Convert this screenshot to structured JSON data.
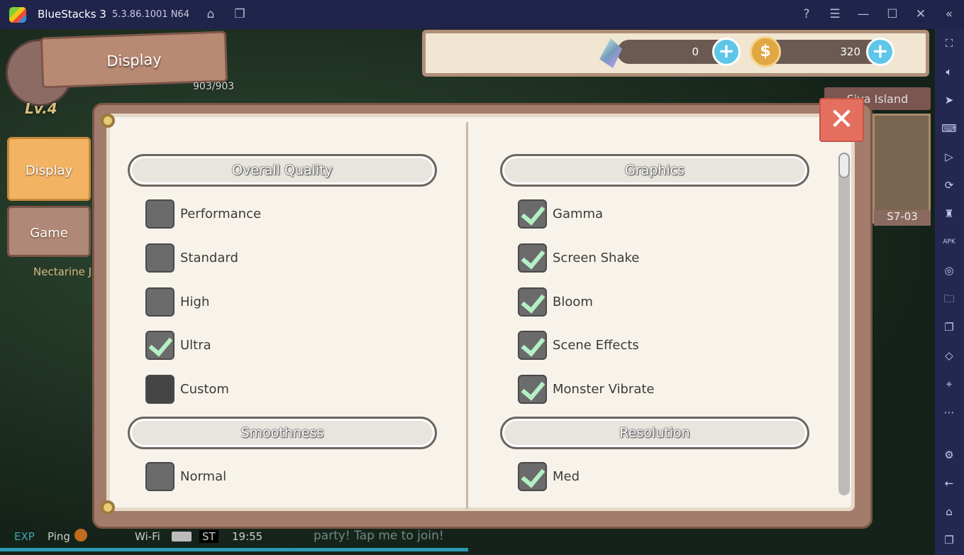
{
  "titlebar": {
    "app": "BlueStacks 3",
    "version": "5.3.86.1001 N64",
    "icons": [
      "home-icon",
      "multi-instance-icon",
      "help-icon",
      "menu-icon",
      "minimize-icon",
      "maximize-icon",
      "close-icon",
      "collapse-icon"
    ]
  },
  "sidebar": {
    "icons": [
      "fullscreen-icon",
      "volume-icon",
      "pointer-icon",
      "keyboard-icon",
      "macro-icon",
      "rotate-icon",
      "shake-icon",
      "apk-icon",
      "screenshot-icon",
      "folder-icon",
      "multi-window-icon",
      "eraser-icon",
      "location-icon",
      "more-icon",
      "settings-icon",
      "back-icon",
      "home-icon",
      "recents-icon"
    ]
  },
  "hud": {
    "sign_title": "Display",
    "level": "Lv.4",
    "hp": "903/903",
    "gems": "0",
    "coins": "320",
    "island": "Siva Island",
    "stage": "S7-03",
    "npc": "Nectarine Je"
  },
  "tabs": [
    {
      "label": "Display",
      "active": true
    },
    {
      "label": "Game",
      "active": false
    }
  ],
  "left": {
    "quality_header": "Overall Quality",
    "quality": [
      {
        "label": "Performance",
        "checked": false
      },
      {
        "label": "Standard",
        "checked": false
      },
      {
        "label": "High",
        "checked": false
      },
      {
        "label": "Ultra",
        "checked": true
      },
      {
        "label": "Custom",
        "checked": false
      }
    ],
    "smooth_header": "Smoothness",
    "smooth": [
      {
        "label": "Normal",
        "checked": false
      }
    ]
  },
  "right": {
    "graphics_header": "Graphics",
    "graphics": [
      {
        "label": "Gamma",
        "checked": true
      },
      {
        "label": "Screen Shake",
        "checked": true
      },
      {
        "label": "Bloom",
        "checked": true
      },
      {
        "label": "Scene Effects",
        "checked": true
      },
      {
        "label": "Monster Vibrate",
        "checked": true
      }
    ],
    "res_header": "Resolution",
    "res": [
      {
        "label": "Med",
        "checked": true
      }
    ]
  },
  "status": {
    "exp": "EXP",
    "ping": "Ping",
    "wifi": "Wi-Fi",
    "st": "ST",
    "time": "19:55",
    "chat": "party! Tap me to join!"
  },
  "colors": {
    "titlebar": "#21244a",
    "sidebar": "#242851",
    "tab_active": "#f2b462",
    "close": "#e56f5f"
  }
}
